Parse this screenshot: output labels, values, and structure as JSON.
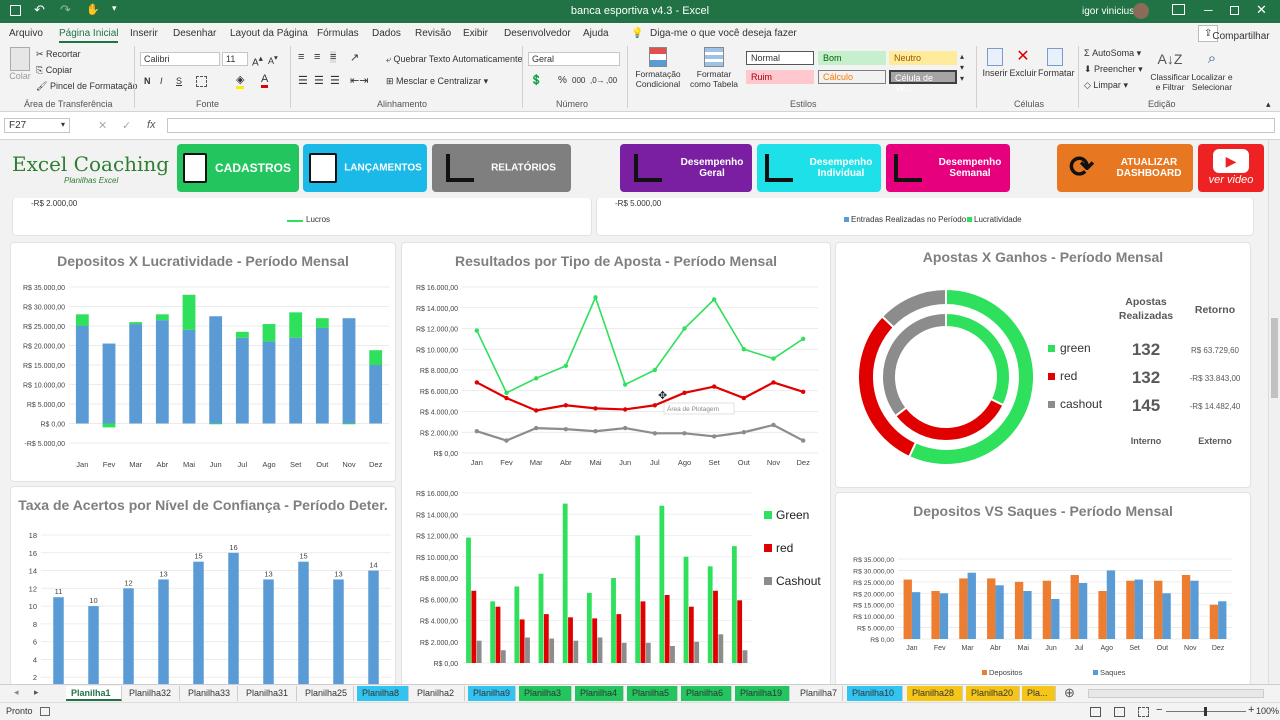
{
  "window": {
    "title": "banca esportiva v4.3  -  Excel",
    "user": "igor vinicius"
  },
  "ribbon_tabs": [
    "Arquivo",
    "Página Inicial",
    "Inserir",
    "Desenhar",
    "Layout da Página",
    "Fórmulas",
    "Dados",
    "Revisão",
    "Exibir",
    "Desenvolvedor",
    "Ajuda"
  ],
  "tell_me": "Diga-me o que você deseja fazer",
  "share": "Compartilhar",
  "ribbon": {
    "clipboard": {
      "paste": "Colar",
      "cut": "Recortar",
      "copy": "Copiar",
      "painter": "Pincel de Formatação",
      "group": "Área de Transferência"
    },
    "font": {
      "name": "Calibri",
      "size": "11",
      "group": "Fonte",
      "bold": "N",
      "italic": "I",
      "underline": "S"
    },
    "alignment": {
      "wrap": "Quebrar Texto Automaticamente",
      "merge": "Mesclar e Centralizar",
      "group": "Alinhamento"
    },
    "number": {
      "format": "Geral",
      "group": "Número",
      "pct": "%",
      "thousands": "000"
    },
    "styles": {
      "cond": "Formatação Condicional",
      "table": "Formatar como Tabela",
      "group": "Estilos",
      "normal": "Normal",
      "bom": "Bom",
      "neutro": "Neutro",
      "ruim": "Ruim",
      "calculo": "Cálculo",
      "celula": "Célula de Ve..."
    },
    "cells": {
      "insert": "Inserir",
      "delete": "Excluir",
      "format": "Formatar",
      "group": "Células"
    },
    "editing": {
      "autosum": "AutoSoma",
      "fill": "Preencher",
      "clear": "Limpar",
      "sort": "Classificar e Filtrar",
      "find": "Localizar e Selecionar",
      "group": "Edição"
    }
  },
  "formula_bar": {
    "name_box": "F27",
    "fx": "fx",
    "value": ""
  },
  "nav": {
    "logo_main": "Excel Coaching",
    "logo_sub": "Planilhas Excel",
    "cadastros": "CADASTROS",
    "lancamentos": "LANÇAMENTOS",
    "relatorios": "RELATÓRIOS",
    "desemp_geral": "Desempenho Geral",
    "desemp_indiv": "Desempenho Individual",
    "desemp_semanal": "Desempenho Semanal",
    "atualizar": "ATUALIZAR DASHBOARD",
    "video": "ver video"
  },
  "top_partial": {
    "left_tick": "-R$ 2.000,00",
    "left_legend": "Lucros",
    "right_tick": "-R$ 5.000,00",
    "right_legend1": "Entradas Realizadas no Período",
    "right_legend2": "Lucratividade"
  },
  "colors": {
    "blue": "#5b9bd5",
    "green": "#2ee05c",
    "red": "#e00000",
    "gray": "#8c8c8c",
    "orange": "#ed7d31"
  },
  "months": [
    "Jan",
    "Fev",
    "Mar",
    "Abr",
    "Mai",
    "Jun",
    "Jul",
    "Ago",
    "Set",
    "Out",
    "Nov",
    "Dez"
  ],
  "chart_data": [
    {
      "type": "bar",
      "title": "Depositos X Lucratividade - Período Mensal",
      "categories": [
        "Jan",
        "Fev",
        "Mar",
        "Abr",
        "Mai",
        "Jun",
        "Jul",
        "Ago",
        "Set",
        "Out",
        "Nov",
        "Dez"
      ],
      "series": [
        {
          "name": "Entradas",
          "values": [
            25000,
            20500,
            25500,
            26500,
            24000,
            27500,
            22000,
            21000,
            22000,
            24500,
            27000,
            15000
          ]
        },
        {
          "name": "Lucratividade",
          "values": [
            3000,
            -1000,
            500,
            1500,
            9000,
            -200,
            1500,
            4500,
            6500,
            2500,
            -200,
            3800
          ]
        }
      ],
      "yticks": [
        "-R$ 5.000,00",
        "R$ 0,00",
        "R$ 5.000,00",
        "R$ 10.000,00",
        "R$ 15.000,00",
        "R$ 20.000,00",
        "R$ 25.000,00",
        "R$ 30.000,00",
        "R$ 35.000,00"
      ],
      "ylim": [
        -5000,
        35000
      ]
    },
    {
      "type": "line",
      "title": "Resultados por Tipo de Aposta - Período Mensal",
      "categories": [
        "Jan",
        "Fev",
        "Mar",
        "Abr",
        "Mai",
        "Jun",
        "Jul",
        "Ago",
        "Set",
        "Out",
        "Nov",
        "Dez"
      ],
      "series": [
        {
          "name": "green",
          "values": [
            11800,
            5800,
            7200,
            8400,
            15000,
            6600,
            8000,
            12000,
            14800,
            10000,
            9100,
            11000
          ]
        },
        {
          "name": "red",
          "values": [
            6800,
            5300,
            4100,
            4600,
            4300,
            4200,
            4600,
            5800,
            6400,
            5300,
            6800,
            5900
          ]
        },
        {
          "name": "cashout",
          "values": [
            2100,
            1200,
            2400,
            2300,
            2100,
            2400,
            1900,
            1900,
            1600,
            2000,
            2700,
            1200
          ]
        }
      ],
      "yticks": [
        "R$ 0,00",
        "R$ 2.000,00",
        "R$ 4.000,00",
        "R$ 6.000,00",
        "R$ 8.000,00",
        "R$ 10.000,00",
        "R$ 12.000,00",
        "R$ 14.000,00",
        "R$ 16.000,00"
      ],
      "ylim": [
        0,
        16000
      ],
      "tooltip": "Área de Plotagem"
    },
    {
      "type": "bar",
      "title": "",
      "categories": [
        "Jan",
        "Fev",
        "Mar",
        "Abr",
        "Mai",
        "Jun",
        "Jul",
        "Ago",
        "Set",
        "Out",
        "Nov",
        "Dez"
      ],
      "series": [
        {
          "name": "Green",
          "values": [
            11800,
            5800,
            7200,
            8400,
            15000,
            6600,
            8000,
            12000,
            14800,
            10000,
            9100,
            11000
          ]
        },
        {
          "name": "red",
          "values": [
            6800,
            5300,
            4100,
            4600,
            4300,
            4200,
            4600,
            5800,
            6400,
            5300,
            6800,
            5900
          ]
        },
        {
          "name": "Cashout",
          "values": [
            2100,
            1200,
            2400,
            2300,
            2100,
            2400,
            1900,
            1900,
            1600,
            2000,
            2700,
            1200
          ]
        }
      ],
      "yticks": [
        "R$ 0,00",
        "R$ 2.000,00",
        "R$ 4.000,00",
        "R$ 6.000,00",
        "R$ 8.000,00",
        "R$ 10.000,00",
        "R$ 12.000,00",
        "R$ 14.000,00",
        "R$ 16.000,00"
      ],
      "ylim": [
        0,
        16000
      ]
    },
    {
      "type": "pie",
      "title": "Apostas X Ganhos - Período Mensal",
      "labels": [
        "green",
        "red",
        "cashout"
      ],
      "inner_values": [
        132,
        132,
        145
      ],
      "outer_values": [
        63729.6,
        33843.0,
        14482.4
      ],
      "col_head_1": "Apostas Realizadas",
      "col_head_2": "Retorno",
      "returns": [
        "R$ 63.729,60",
        "-R$ 33.843,00",
        "-R$ 14.482,40"
      ],
      "foot_1": "Interno",
      "foot_2": "Externo"
    },
    {
      "type": "bar",
      "title": "Taxa de Acertos por Nível de Confiança - Período Deter.",
      "categories": [
        "10%",
        "20%",
        "30%",
        "40%",
        "50%",
        "60%",
        "70%",
        "80%",
        "90%",
        "100%"
      ],
      "values": [
        11,
        10,
        12,
        13,
        15,
        16,
        13,
        15,
        13,
        14
      ],
      "yticks": [
        "0",
        "2",
        "4",
        "6",
        "8",
        "10",
        "12",
        "14",
        "16",
        "18"
      ],
      "ylim": [
        0,
        18
      ]
    },
    {
      "type": "bar",
      "title": "Depositos VS Saques - Período Mensal",
      "categories": [
        "Jan",
        "Fev",
        "Mar",
        "Abr",
        "Mai",
        "Jun",
        "Jul",
        "Ago",
        "Set",
        "Out",
        "Nov",
        "Dez"
      ],
      "series": [
        {
          "name": "Depositos",
          "values": [
            26000,
            21000,
            26500,
            26500,
            25000,
            25500,
            28000,
            21000,
            25500,
            25500,
            28000,
            15000
          ]
        },
        {
          "name": "Saques",
          "values": [
            20500,
            20000,
            29000,
            23500,
            21000,
            17500,
            24500,
            30000,
            26000,
            20000,
            25500,
            16500
          ]
        }
      ],
      "yticks": [
        "R$ 0,00",
        "R$ 5.000,00",
        "R$ 10.000,00",
        "R$ 15.000,00",
        "R$ 20.000,00",
        "R$ 25.000,00",
        "R$ 30.000,00",
        "R$ 35.000,00"
      ],
      "ylim": [
        0,
        35000
      ]
    }
  ],
  "sheet_tabs": [
    {
      "name": "Planilha1",
      "c": "#fff"
    },
    {
      "name": "Planilha32",
      "c": ""
    },
    {
      "name": "Planilha33",
      "c": ""
    },
    {
      "name": "Planilha31",
      "c": ""
    },
    {
      "name": "Planilha25",
      "c": ""
    },
    {
      "name": "Planilha8",
      "c": "#33c3f0"
    },
    {
      "name": "Planilha2",
      "c": ""
    },
    {
      "name": "Planilha9",
      "c": "#33c3f0"
    },
    {
      "name": "Planilha3",
      "c": "#22c55e"
    },
    {
      "name": "Planilha4",
      "c": "#22c55e"
    },
    {
      "name": "Planilha5",
      "c": "#22c55e"
    },
    {
      "name": "Planilha6",
      "c": "#22c55e"
    },
    {
      "name": "Planilha19",
      "c": "#22c55e"
    },
    {
      "name": "Planilha7",
      "c": ""
    },
    {
      "name": "Planilha10",
      "c": "#33c3f0"
    },
    {
      "name": "Planilha28",
      "c": "#f5c518"
    },
    {
      "name": "Planilha20",
      "c": "#f5c518"
    },
    {
      "name": "Pla...",
      "c": "#f5c518"
    }
  ],
  "status": {
    "ready": "Pronto",
    "zoom": "100%"
  }
}
